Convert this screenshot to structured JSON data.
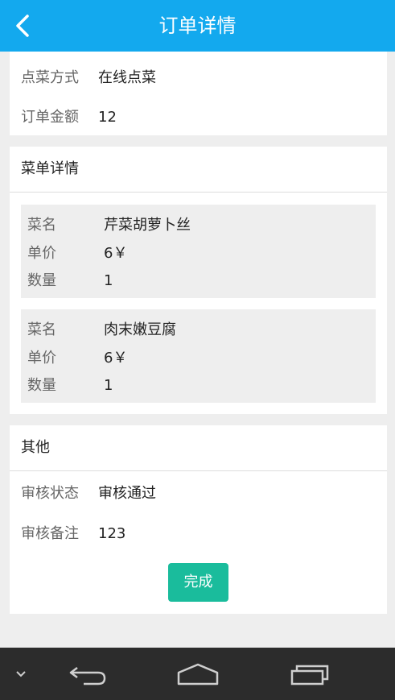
{
  "header": {
    "title": "订单详情"
  },
  "order": {
    "method_label": "点菜方式",
    "method_value": "在线点菜",
    "amount_label": "订单金额",
    "amount_value": "12"
  },
  "menu": {
    "title": "菜单详情",
    "dishes": [
      {
        "name_label": "菜名",
        "name_value": "芹菜胡萝卜丝",
        "price_label": "单价",
        "price_value": "6￥",
        "qty_label": "数量",
        "qty_value": "1"
      },
      {
        "name_label": "菜名",
        "name_value": "肉末嫩豆腐",
        "price_label": "单价",
        "price_value": "6￥",
        "qty_label": "数量",
        "qty_value": "1"
      }
    ]
  },
  "other": {
    "title": "其他",
    "status_label": "审核状态",
    "status_value": "审核通过",
    "remark_label": "审核备注",
    "remark_value": "123",
    "done_label": "完成"
  },
  "colors": {
    "header": "#13a9ee",
    "done_button": "#1abc9c",
    "navbar": "#2c2c2c"
  },
  "nav": {
    "icons": [
      "chevron-down-icon",
      "back-icon",
      "home-icon",
      "recent-apps-icon"
    ]
  }
}
